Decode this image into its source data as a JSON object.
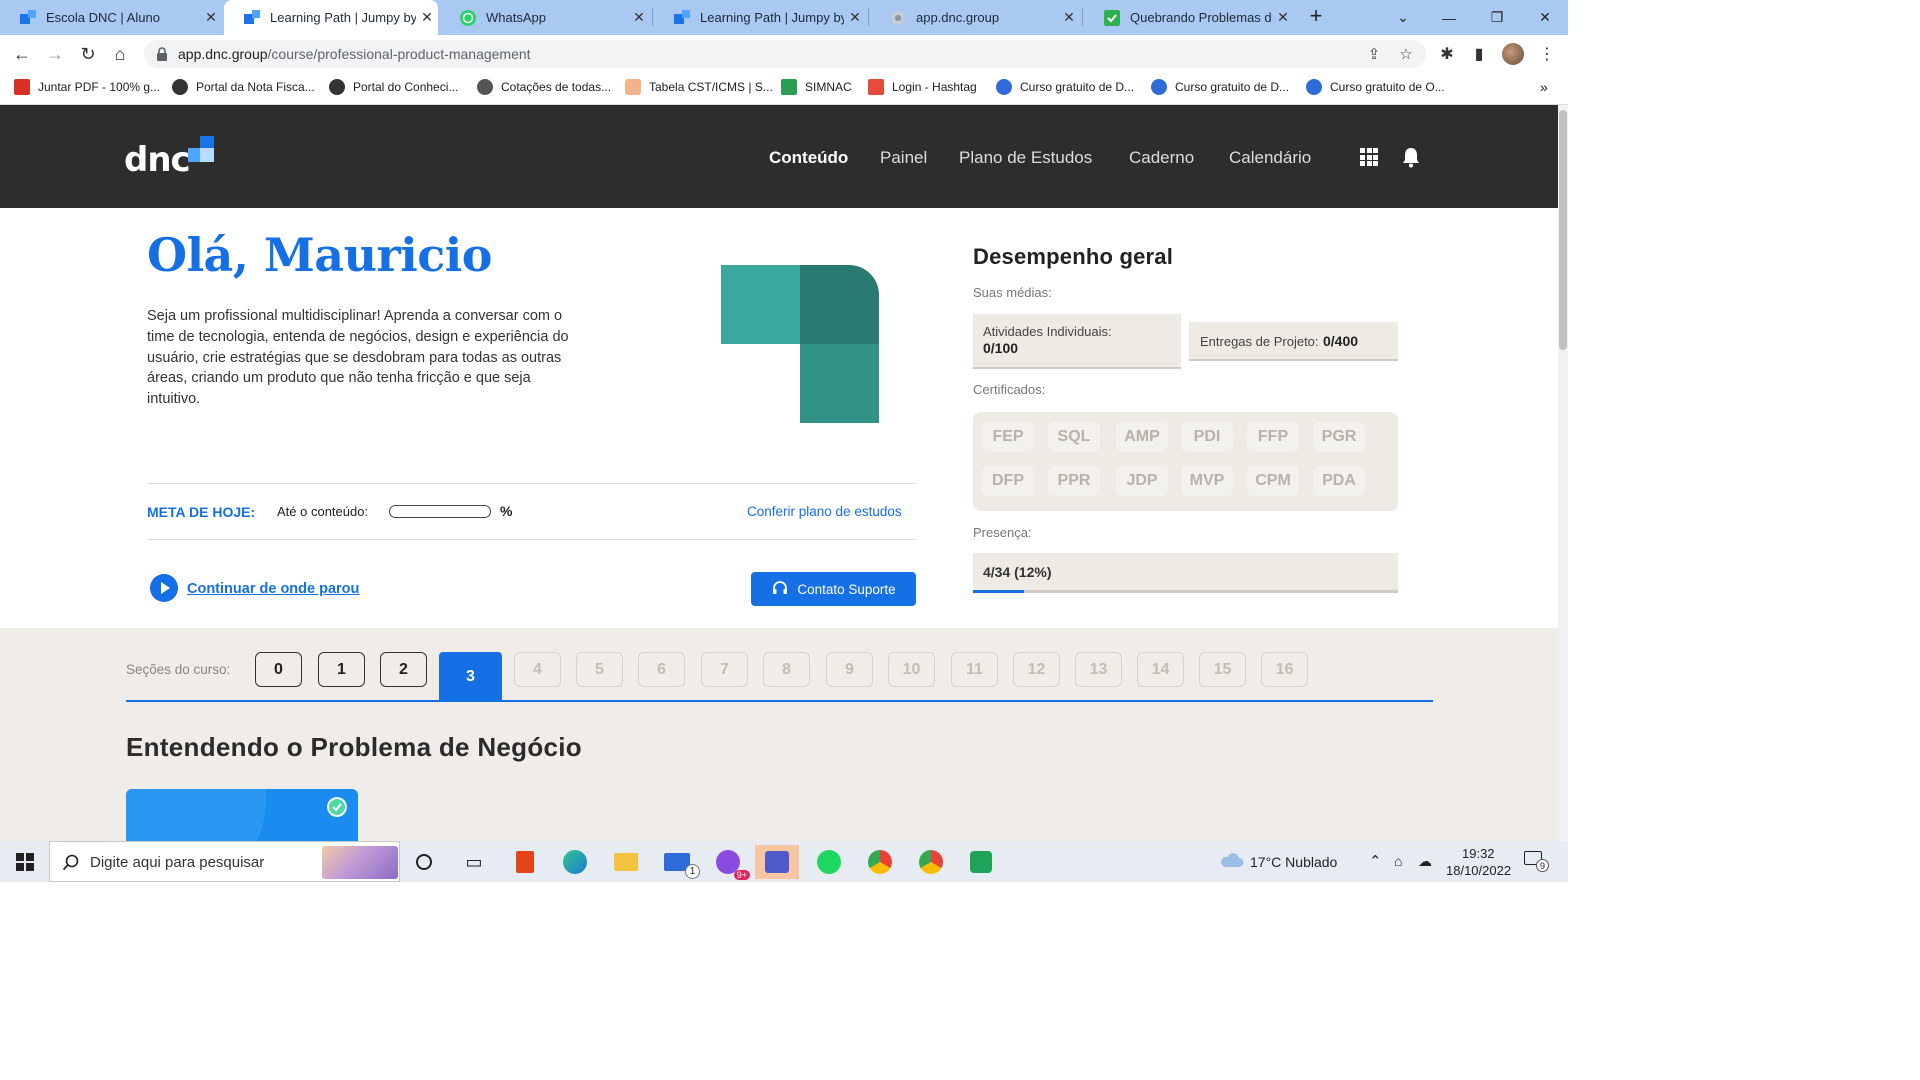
{
  "browser": {
    "tabs": [
      {
        "title": "Escola DNC | Aluno",
        "active": false
      },
      {
        "title": "Learning Path | Jumpy by DNC",
        "active": true
      },
      {
        "title": "WhatsApp",
        "active": false
      },
      {
        "title": "Learning Path | Jumpy by DNC",
        "active": false
      },
      {
        "title": "app.dnc.group",
        "active": false
      },
      {
        "title": "Quebrando Problemas de Negócio",
        "active": false
      }
    ],
    "new_tab": "+",
    "url_host": "app.dnc.group",
    "url_path": "/course/professional-product-management",
    "bookmarks": [
      "Juntar PDF - 100% g...",
      "Portal da Nota Fisca...",
      "Portal do Conheci...",
      "Cotações de todas...",
      "Tabela CST/ICMS | S...",
      "SIMNAC",
      "Login - Hashtag",
      "Curso gratuito de D...",
      "Curso gratuito de D...",
      "Curso gratuito de O..."
    ],
    "bookmarks_overflow": "»"
  },
  "site": {
    "logo": "dnc",
    "nav": [
      {
        "label": "Conteúdo",
        "active": true
      },
      {
        "label": "Painel",
        "active": false
      },
      {
        "label": "Plano de Estudos",
        "active": false
      },
      {
        "label": "Caderno",
        "active": false
      },
      {
        "label": "Calendário",
        "active": false
      }
    ]
  },
  "hero": {
    "greeting": "Olá, Mauricio",
    "intro": "Seja um profissional multidisciplinar! Aprenda a conversar com o time de tecnologia, entenda de negócios, design e experiência do usuário, crie estratégias que se desdobram para todas as outras áreas, criando um produto que não tenha fricção e que seja intuitivo.",
    "meta_label": "META DE HOJE:",
    "meta_sub": "Até o conteúdo:",
    "meta_pct": "%",
    "plan_link": "Conferir plano de estudos",
    "continue_link": "Continuar de onde parou",
    "support_button": "Contato Suporte"
  },
  "performance": {
    "title": "Desempenho geral",
    "averages_label": "Suas médias:",
    "individual_label": "Atividades Individuais:",
    "individual_value": "0/100",
    "project_label": "Entregas de Projeto:",
    "project_value": "0/400",
    "certificates_label": "Certificados:",
    "certificates": [
      "FEP",
      "SQL",
      "AMP",
      "PDI",
      "FFP",
      "PGR",
      "DFP",
      "PPR",
      "JDP",
      "MVP",
      "CPM",
      "PDA"
    ],
    "presence_label": "Presença:",
    "presence_value": "4/34 (12%)",
    "presence_fraction": 0.12
  },
  "sections": {
    "label": "Seções do curso:",
    "items": [
      "0",
      "1",
      "2",
      "3",
      "4",
      "5",
      "6",
      "7",
      "8",
      "9",
      "10",
      "11",
      "12",
      "13",
      "14",
      "15",
      "16"
    ],
    "current": "3",
    "title": "Entendendo o Problema de Negócio"
  },
  "taskbar": {
    "search_placeholder": "Digite aqui para pesquisar",
    "weather": "17°C  Nublado",
    "time": "19:32",
    "date": "18/10/2022",
    "mail_badge": "1",
    "messenger_badge": "9+",
    "notif_badge": "9"
  },
  "colors": {
    "brand_blue": "#1670e5",
    "header_dark": "#2d2d2d",
    "teal_light": "#3aa89c",
    "teal_dark": "#2a7a72",
    "section_bg": "#f0ede8"
  }
}
